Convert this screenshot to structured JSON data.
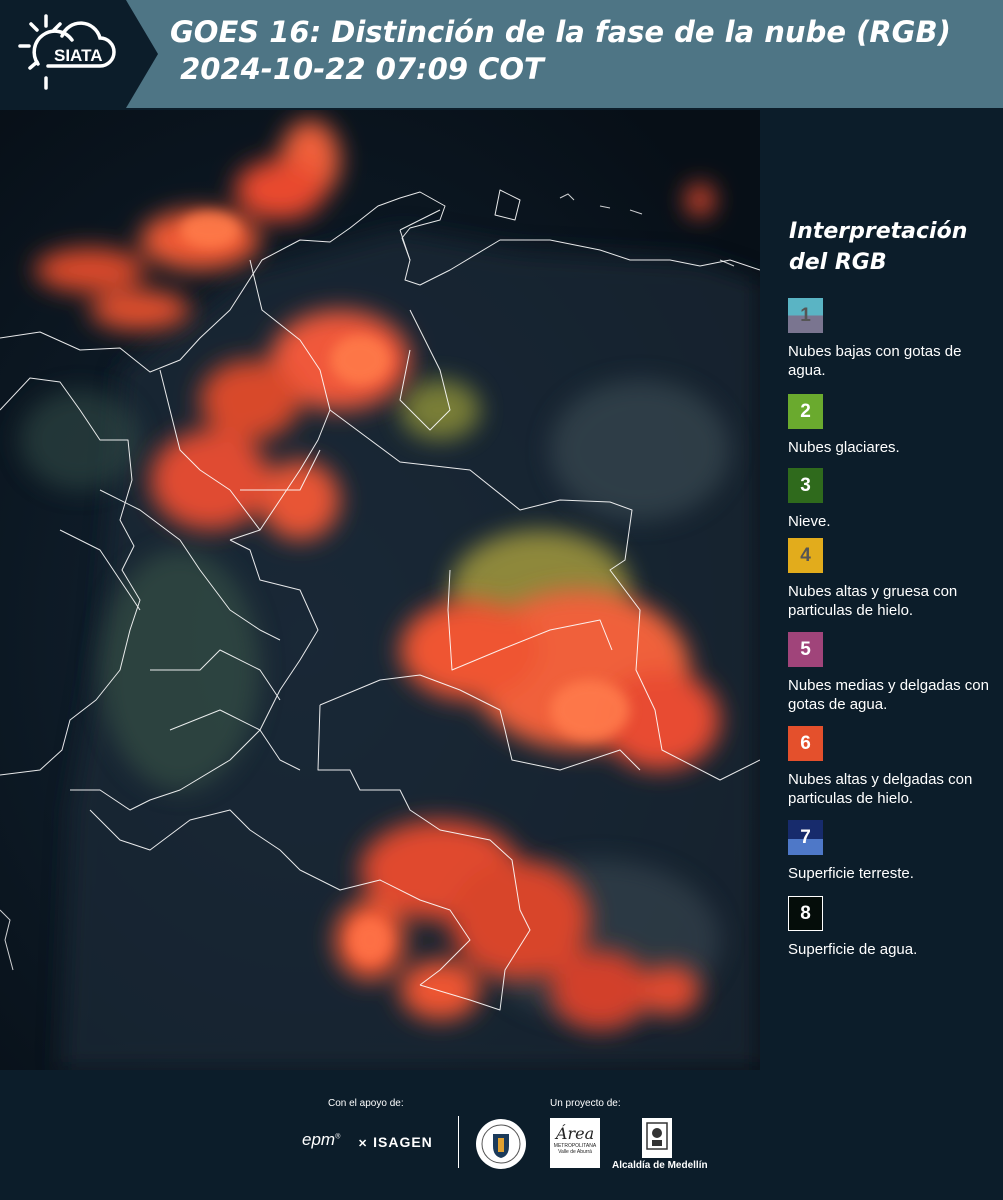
{
  "header": {
    "brand": "SIATA",
    "title_line1": "GOES 16: Distinción de la fase de la nube (RGB)",
    "title_line2": " 2024-10-22 07:09 COT"
  },
  "map": {
    "icon": "satellite-map-image"
  },
  "legend": {
    "title": "Interpretación del RGB",
    "items": [
      {
        "number": "1",
        "label": "Nubes bajas con gotas de agua.",
        "color_top": "#5ab4c4",
        "color_bottom": "#7a7590"
      },
      {
        "number": "2",
        "label": "Nubes glaciares.",
        "color": "#6aaa2e"
      },
      {
        "number": "3",
        "label": "Nieve.",
        "color": "#2f6a1c"
      },
      {
        "number": "4",
        "label": "Nubes altas y gruesa con particulas de hielo.",
        "color": "#e2ac1c"
      },
      {
        "number": "5",
        "label": "Nubes medias y delgadas con gotas de agua.",
        "color": "#a0447a"
      },
      {
        "number": "6",
        "label": "Nubes altas y delgadas con particulas de hielo.",
        "color": "#e4502c"
      },
      {
        "number": "7",
        "label": "Superficie terreste.",
        "color_top": "#172b6c",
        "color_bottom": "#4e78c8"
      },
      {
        "number": "8",
        "label": "Superficie de agua.",
        "color": "#050d0a"
      }
    ]
  },
  "footer": {
    "support_label": "Con el apoyo de:",
    "project_label": "Un proyecto de:",
    "sponsor1": "epm",
    "sponsor2": "ISAGEN",
    "partner1_line1": "METROPOLITANA",
    "partner1_line2": "Valle de Aburrá",
    "partner2": "Alcaldía de Medellín"
  }
}
